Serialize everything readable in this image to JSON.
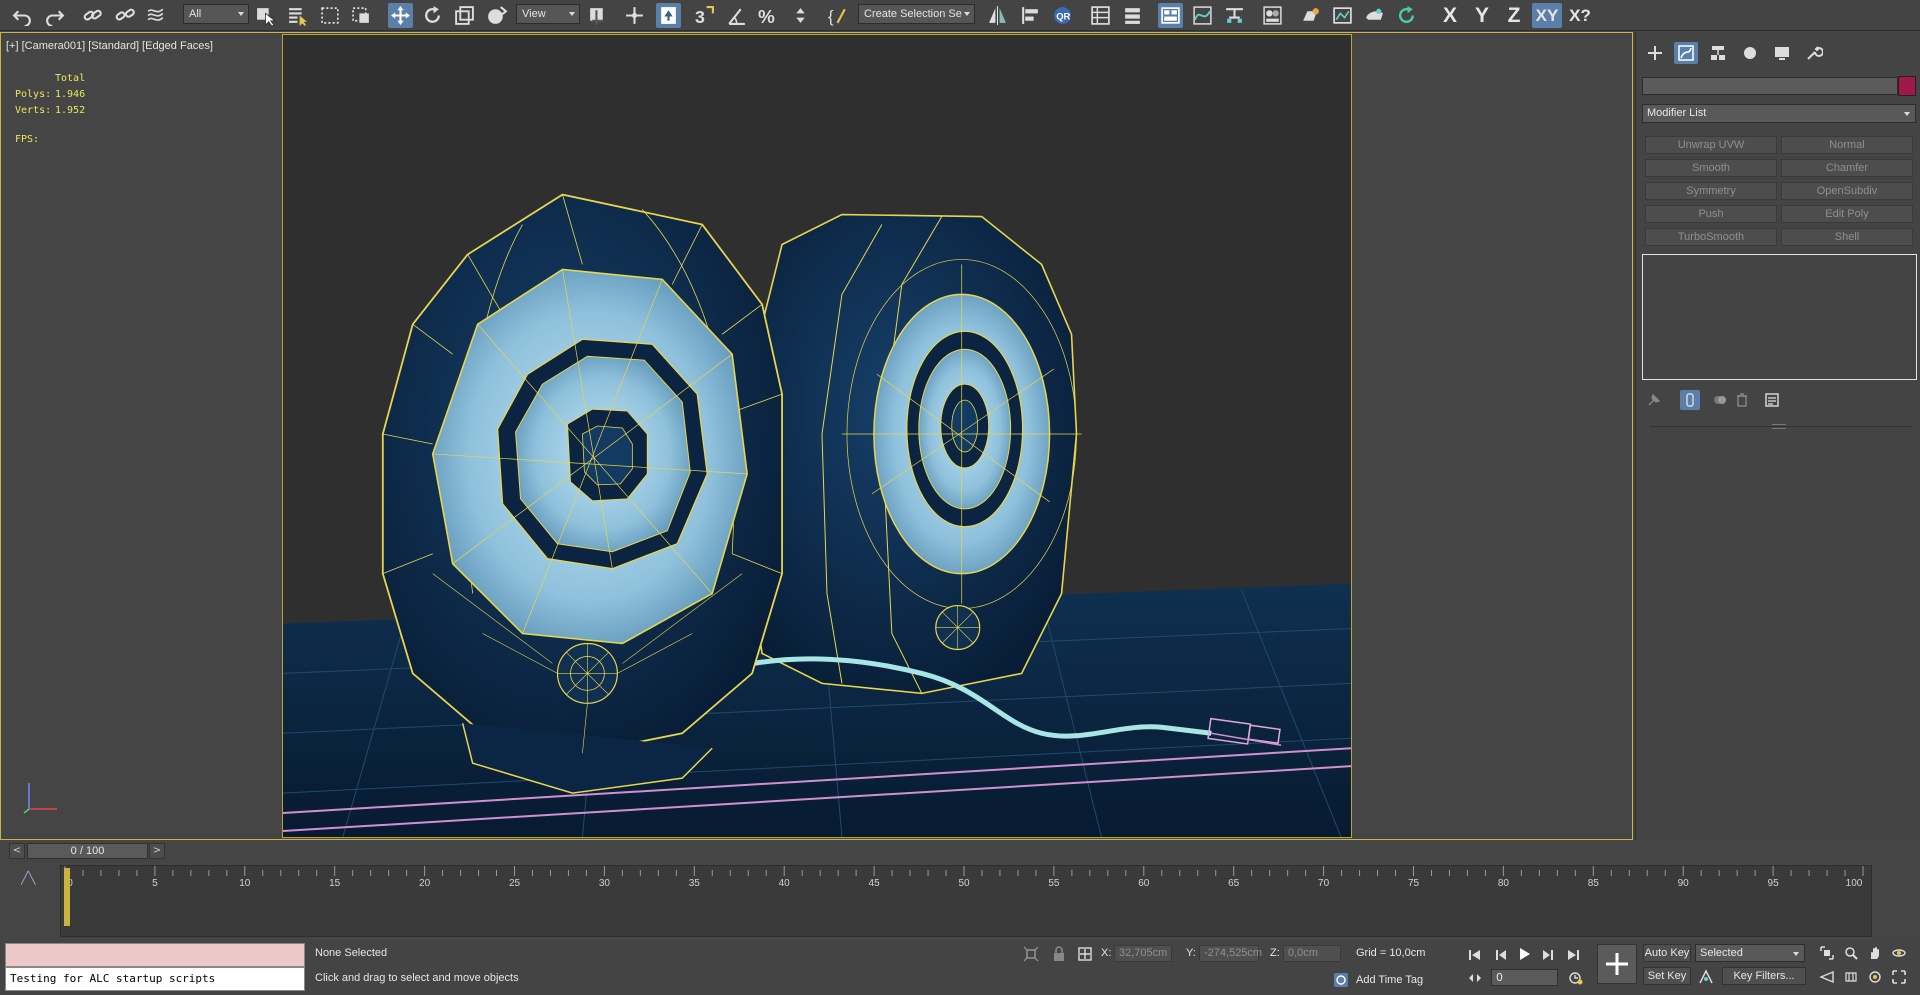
{
  "toolbar": {
    "selection_filter": "All",
    "reference_coord": "View",
    "named_selection": "Create Selection Se",
    "axis_buttons": [
      "X",
      "Y",
      "Z",
      "XY",
      "X?"
    ]
  },
  "viewport": {
    "label": "[+] [Camera001] [Standard] [Edged Faces]",
    "stats_header": "Total",
    "polys_label": "Polys:",
    "polys_value": "1.946",
    "verts_label": "Verts:",
    "verts_value": "1.952",
    "fps_label": "FPS:",
    "colors": {
      "background": "#2f2f2f",
      "mesh_fill": "#0d2a4a",
      "cone_fill": "#8fc1dc",
      "wire": "#e8d54d",
      "cable": "#a8e6e6",
      "frame": "#c9b64a"
    }
  },
  "command_panel": {
    "modifier_list_label": "Modifier List",
    "modifier_buttons": [
      "Unwrap UVW",
      "Normal",
      "Smooth",
      "Chamfer",
      "Symmetry",
      "OpenSubdiv",
      "Push",
      "Edit Poly",
      "TurboSmooth",
      "Shell"
    ],
    "object_color": "#a0174a"
  },
  "timeline": {
    "slider_text": "0 / 100",
    "prev_label": "<",
    "next_label": ">",
    "tick_labels": [
      "0",
      "5",
      "10",
      "15",
      "20",
      "25",
      "30",
      "35",
      "40",
      "45",
      "50",
      "55",
      "60",
      "65",
      "70",
      "75",
      "80",
      "85",
      "90",
      "95",
      "100"
    ]
  },
  "status": {
    "script_listener_text": "Testing for ALC startup scripts",
    "selection_text": "None Selected",
    "prompt_text": "Click and drag to select and move objects",
    "x_label": "X:",
    "x_value": "32,705cm",
    "y_label": "Y:",
    "y_value": "-274,525cm",
    "z_label": "Z:",
    "z_value": "0,0cm",
    "grid_text": "Grid = 10,0cm",
    "add_time_tag": "Add Time Tag",
    "auto_key": "Auto Key",
    "set_key": "Set Key",
    "key_mode": "Selected",
    "key_filters": "Key Filters...",
    "frame_value": "0"
  }
}
